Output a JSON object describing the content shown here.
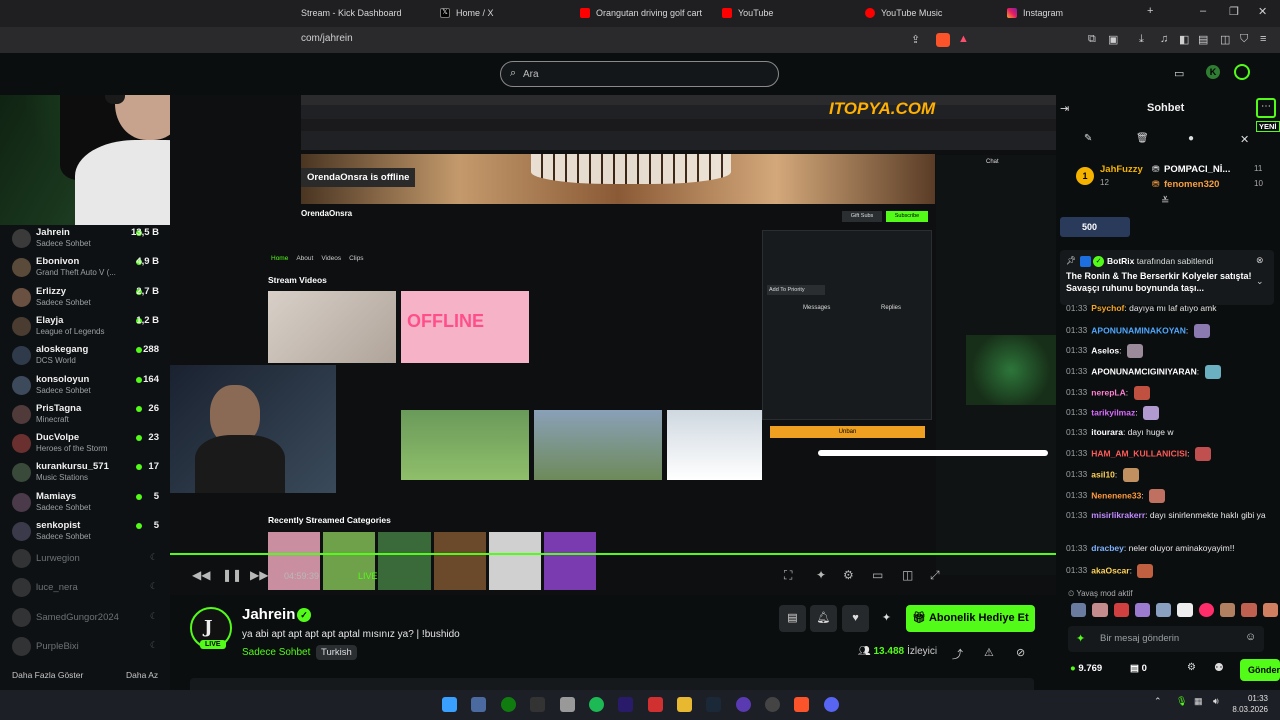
{
  "browser": {
    "tabs": [
      {
        "label": "Stream - Kick Dashboard"
      },
      {
        "label": "Home / X"
      },
      {
        "label": "Orangutan driving golf cart [10"
      },
      {
        "label": "YouTube"
      },
      {
        "label": "YouTube Music"
      },
      {
        "label": "Instagram"
      }
    ],
    "new_tab": "+",
    "url": "com/jahrein"
  },
  "search": {
    "placeholder": "Ara"
  },
  "sidebar": {
    "channels": [
      {
        "name": "Jahrein",
        "category": "Sadece Sohbet",
        "viewers": "13,5 B",
        "color": "#3a3a3a"
      },
      {
        "name": "Ebonivon",
        "category": "Grand Theft Auto V (...",
        "viewers": "4,9 B",
        "color": "#5a4a3a"
      },
      {
        "name": "Erlizzy",
        "category": "Sadece Sohbet",
        "viewers": "2,7 B",
        "color": "#6a5040"
      },
      {
        "name": "Elayja",
        "category": "League of Legends",
        "viewers": "1,2 B",
        "color": "#4a3c30"
      },
      {
        "name": "aloskegang",
        "category": "DCS World",
        "viewers": "288",
        "color": "#2f3a4a"
      },
      {
        "name": "konsoloyun",
        "category": "Sadece Sohbet",
        "viewers": "164",
        "color": "#3c4a5c"
      },
      {
        "name": "PrisTagna",
        "category": "Minecraft",
        "viewers": "26",
        "color": "#503a3a"
      },
      {
        "name": "DucVolpe",
        "category": "Heroes of the Storm",
        "viewers": "23",
        "color": "#6a3030"
      },
      {
        "name": "kurankursu_571",
        "category": "Music Stations",
        "viewers": "17",
        "color": "#3a4a3a"
      },
      {
        "name": "Mamiays",
        "category": "Sadece Sohbet",
        "viewers": "5",
        "color": "#4a3a4a"
      },
      {
        "name": "senkopist",
        "category": "Sadece Sohbet",
        "viewers": "5",
        "color": "#3a3a4a"
      }
    ],
    "offline": [
      {
        "name": "Lurwegion"
      },
      {
        "name": "luce_nera"
      },
      {
        "name": "SamedGungor2024"
      },
      {
        "name": "PurpleBixi"
      }
    ],
    "show_more": "Daha Fazla Göster",
    "show_less": "Daha Az"
  },
  "player": {
    "time": "04:59:39",
    "live": "LIVE"
  },
  "channel": {
    "name": "Jahrein",
    "live_badge": "LIVE",
    "title": "ya abi apt apt apt apt aptal mısınız ya? | !bushido",
    "category": "Sadece Sohbet",
    "tag": "Turkish",
    "gift_button": "Abonelik Hediye Et",
    "viewers": "13.488",
    "viewers_label": "İzleyici"
  },
  "chat": {
    "title": "Sohbet",
    "new_badge": "YENİ",
    "top_gifters": [
      {
        "rank": "1",
        "name": "JahFuzzy",
        "count": "12"
      },
      {
        "name": "POMPACI_Nİ...",
        "count": "11"
      },
      {
        "name": "fenomen320",
        "count": "10"
      }
    ],
    "points": "500",
    "pinned": {
      "by": "BotRix",
      "by_suffix": "tarafından sabitlendi",
      "text": "The Ronin & The Berserkir Kolyeler satışta! Savaşçı ruhunu boynunda taşı..."
    },
    "messages": [
      {
        "time": "01:33",
        "user": "Psychof",
        "color": "#f5a623",
        "text": "dayıya mı laf atıyo amk"
      },
      {
        "time": "01:33",
        "user": "APONUNAMINAKOYAN",
        "color": "#4fa7ff",
        "text": ""
      },
      {
        "time": "01:33",
        "user": "Aselos",
        "color": "#ffffff",
        "text": ""
      },
      {
        "time": "01:33",
        "user": "APONUNAMCIGINIYARAN",
        "color": "#ffffff",
        "text": ""
      },
      {
        "time": "01:33",
        "user": "nerepLA",
        "color": "#ff7fd0",
        "text": ""
      },
      {
        "time": "01:33",
        "user": "tarikyilmaz",
        "color": "#d86bff",
        "text": ""
      },
      {
        "time": "01:33",
        "user": "itourara",
        "color": "#ffffff",
        "text": "dayı huge w"
      },
      {
        "time": "01:33",
        "user": "HAM_AM_KULLANICISI",
        "color": "#ff5a5a",
        "text": ""
      },
      {
        "time": "01:33",
        "user": "asil10",
        "color": "#ffd35a",
        "text": ""
      },
      {
        "time": "01:33",
        "user": "Nenenene33",
        "color": "#ff9a3c",
        "text": ""
      },
      {
        "time": "01:33",
        "user": "misirlikrakerr",
        "color": "#c08bff",
        "text": "dayı sinirlenmekte haklı gibi ya"
      },
      {
        "time": "01:33",
        "user": "dracbey",
        "color": "#7fb2ff",
        "text": "neler oluyor aminakoyayim!!"
      },
      {
        "time": "01:33",
        "user": "akaOscar",
        "color": "#ffd35a",
        "text": ""
      }
    ],
    "slow_mode": "Yavaş mod aktif",
    "input_placeholder": "Bir mesaj gönderin",
    "points_balance": "9.769",
    "unread": "0",
    "send_button": "Gönder"
  },
  "taskbar": {
    "time": "01:33",
    "date": "8.03.2026"
  },
  "embedded_screen": {
    "offline_label": "OrendaOnsra is offline",
    "channel_name": "OrendaOnsra",
    "tabs": [
      "Home",
      "About",
      "Videos",
      "Clips"
    ],
    "section_videos": "Stream Videos",
    "offline_thumb": "OFFLINE",
    "section_categories": "Recently Streamed Categories",
    "chat_title": "Chat",
    "messages_tab": "Messages",
    "replies_tab": "Replies",
    "unban": "Unban",
    "gift_subs": "Gift Subs",
    "subscribe": "Subscribe",
    "add_priority": "Add To Priority",
    "watermark": "ITOPYA.COM"
  }
}
